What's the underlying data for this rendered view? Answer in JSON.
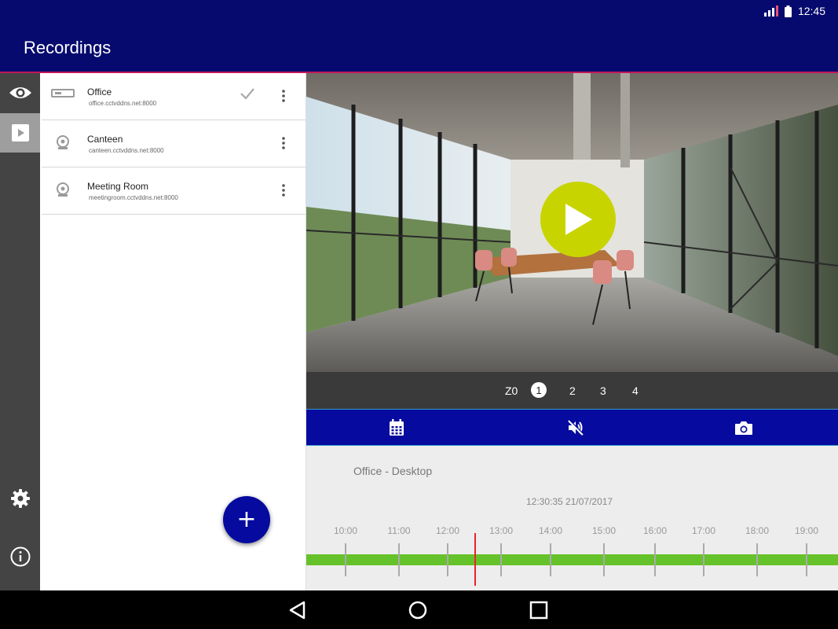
{
  "status_bar": {
    "time": "12:45",
    "signal_icon": "signal-icon",
    "battery_icon": "battery-icon"
  },
  "app_bar": {
    "title": "Recordings"
  },
  "rail": {
    "items": [
      {
        "icon": "eye-icon",
        "active": false
      },
      {
        "icon": "play-icon",
        "active": true
      },
      {
        "icon": "gear-icon",
        "active": false
      },
      {
        "icon": "info-icon",
        "active": false
      }
    ]
  },
  "devices": [
    {
      "name": "Office",
      "address": "office.cctvddns.net:8000",
      "type": "dvr",
      "selected": true
    },
    {
      "name": "Canteen",
      "address": "canteen.cctvddns.net:8000",
      "type": "camera",
      "selected": false
    },
    {
      "name": "Meeting Room",
      "address": "meetingroom.cctvddns.net:8000",
      "type": "camera",
      "selected": false
    }
  ],
  "fab": {
    "label": "+"
  },
  "video": {
    "play_icon": "play-icon"
  },
  "zoom": {
    "label": "Z0",
    "levels": [
      "1",
      "2",
      "3",
      "4"
    ],
    "selected": "1"
  },
  "toolbar": {
    "icons": [
      "calendar-icon",
      "mute-icon",
      "camera-icon"
    ]
  },
  "timeline": {
    "camera_label": "Office - Desktop",
    "timestamp": "12:30:35   21/07/2017",
    "hours": [
      "10:00",
      "11:00",
      "12:00",
      "13:00",
      "14:00",
      "15:00",
      "16:00",
      "17:00",
      "18:00",
      "19:00"
    ],
    "colors": {
      "recording": "#66c22a",
      "cursor": "#e8232a"
    }
  },
  "colors": {
    "primary": "#060a6e",
    "accent": "#c8d400",
    "fab": "#060a9e"
  }
}
